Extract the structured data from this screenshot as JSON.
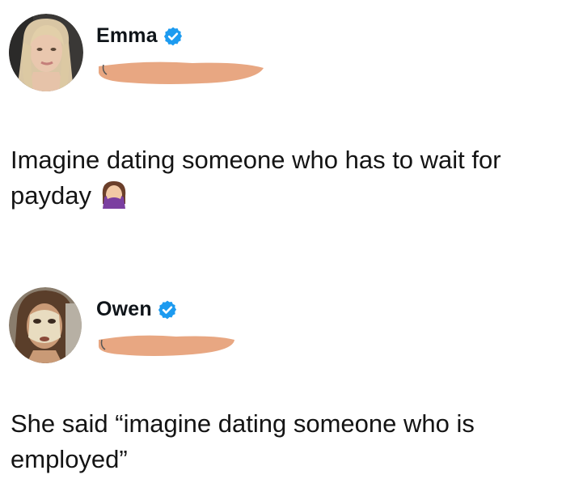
{
  "tweets": [
    {
      "author": {
        "name": "Emma",
        "verified": true
      },
      "text": "Imagine dating someone who has to wait for payday",
      "emoji": "face-palm-woman-emoji"
    },
    {
      "author": {
        "name": "Owen",
        "verified": true
      },
      "text": "She said “imagine dating someone who is employed”"
    }
  ],
  "colors": {
    "verified_badge": "#1d9bf0",
    "redaction": "#e8a782",
    "text": "#141414"
  }
}
